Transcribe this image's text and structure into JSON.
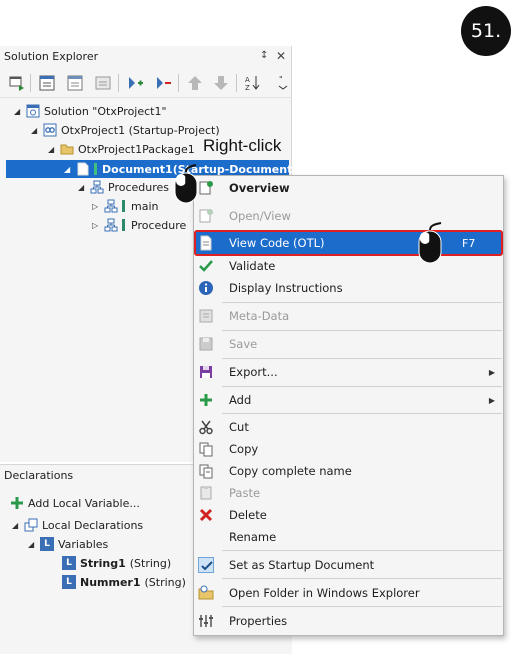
{
  "step_badge": "51.",
  "solution_explorer": {
    "title": "Solution Explorer",
    "pin_icon": "pin-icon",
    "close_icon": "close-icon",
    "toolbar_icons": [
      "sync-icon",
      "properties-icon",
      "show-all-files-icon",
      "filter-icon",
      "add-item-icon",
      "remove-item-icon",
      "move-up-icon",
      "move-down-icon",
      "sort-az-icon",
      "overflow-icon"
    ],
    "tree": [
      {
        "label": "Solution \"OtxProject1\"",
        "icon": "solution-icon",
        "expanded": true
      },
      {
        "label": "OtxProject1 (Startup-Project)",
        "icon": "project-icon",
        "expanded": true
      },
      {
        "label": "OtxProject1Package1",
        "icon": "folder-icon",
        "expanded": true
      },
      {
        "label": "Document1",
        "suffix": " (Startup-Document)",
        "icon": "document-icon",
        "expanded": true,
        "selected": true
      },
      {
        "label": "Procedures",
        "icon": "procedures-icon",
        "expanded": true
      },
      {
        "label": "main",
        "icon": "procedure-icon",
        "expanded": false
      },
      {
        "label": "Procedure",
        "icon": "procedure-icon",
        "expanded": false
      }
    ]
  },
  "annotation": {
    "right_click": "Right-click"
  },
  "declarations": {
    "title": "Declarations",
    "add_local_variable": "Add Local Variable...",
    "local_declarations": "Local Declarations",
    "variables": "Variables",
    "items": [
      {
        "name": "String1",
        "type": "(String)"
      },
      {
        "name": "Nummer1",
        "type": "(String)"
      }
    ]
  },
  "context_menu": {
    "overview": "Overview",
    "open_view": "Open/View",
    "view_code": "View Code (OTL)",
    "view_code_shortcut": "F7",
    "validate": "Validate",
    "display_instructions": "Display Instructions",
    "meta_data": "Meta-Data",
    "save": "Save",
    "export": "Export...",
    "add": "Add",
    "cut": "Cut",
    "copy": "Copy",
    "copy_complete_name": "Copy complete name",
    "paste": "Paste",
    "delete": "Delete",
    "rename": "Rename",
    "set_startup": "Set as Startup Document",
    "open_folder": "Open Folder in Windows Explorer",
    "properties": "Properties"
  },
  "colors": {
    "selection": "#1c6ccb",
    "highlight_border": "#e02020",
    "panel_bg": "#f5f5f5"
  }
}
